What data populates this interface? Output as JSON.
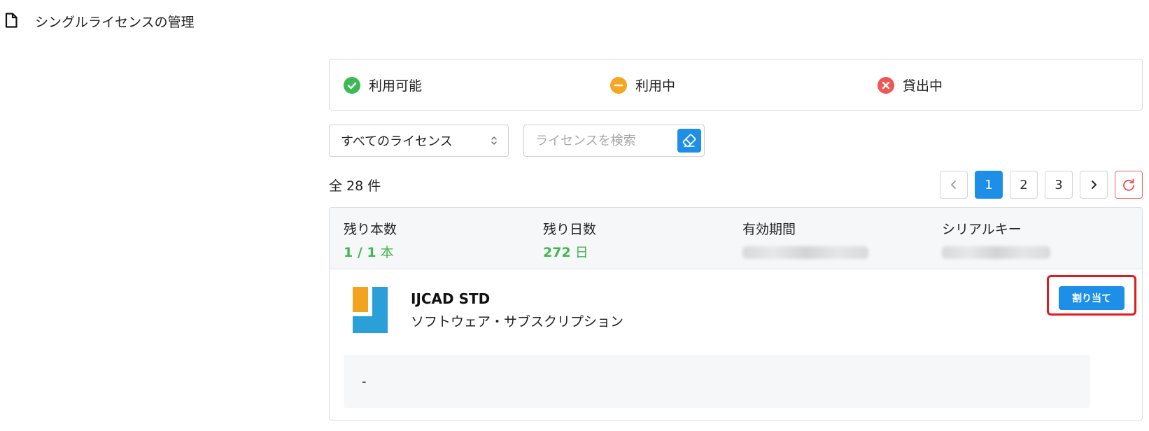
{
  "page": {
    "title": "シングルライセンスの管理"
  },
  "legend": {
    "items": [
      {
        "label": "利用可能",
        "color": "#3cb955",
        "icon": "check-circle-icon"
      },
      {
        "label": "利用中",
        "color": "#f5a623",
        "icon": "minus-circle-icon"
      },
      {
        "label": "貸出中",
        "color": "#f05656",
        "icon": "x-circle-icon"
      }
    ]
  },
  "filters": {
    "select_value": "すべてのライセンス",
    "search_placeholder": "ライセンスを検索",
    "search_value": ""
  },
  "list": {
    "total_count": "全 28 件",
    "pages": [
      "1",
      "2",
      "3"
    ],
    "current_page": "1",
    "prev_icon": "chevron-left-icon",
    "next_icon": "chevron-right-icon",
    "refresh_icon": "refresh-icon"
  },
  "license_card": {
    "stats": {
      "remaining_count_label": "残り本数",
      "remaining_count_number": "1 / 1",
      "remaining_count_unit": " 本",
      "remaining_days_label": "残り日数",
      "remaining_days_number": "272",
      "remaining_days_unit": " 日",
      "validity_label": "有効期間",
      "serial_label": "シリアルキー"
    },
    "product": {
      "name": "IJCAD STD",
      "type": "ソフトウェア・サブスクリプション",
      "assign_label": "割り当て"
    },
    "note": "-"
  },
  "colors": {
    "accent": "#1e8fe6",
    "success": "#43b652",
    "highlight": "#e3191c"
  }
}
